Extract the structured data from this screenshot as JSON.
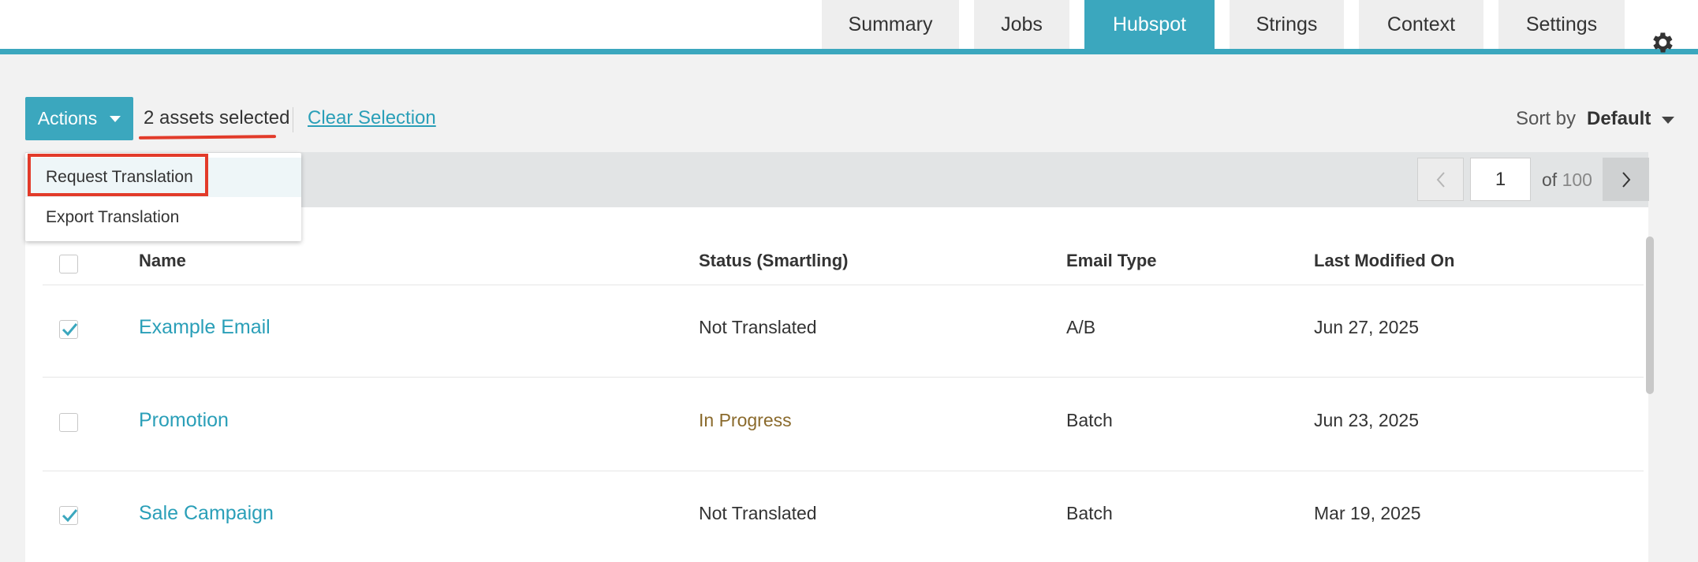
{
  "tabs": [
    {
      "label": "Summary"
    },
    {
      "label": "Jobs"
    },
    {
      "label": "Hubspot"
    },
    {
      "label": "Strings"
    },
    {
      "label": "Context"
    },
    {
      "label": "Settings"
    }
  ],
  "active_tab": "Hubspot",
  "toolbar": {
    "actions_label": "Actions",
    "selected_text": "2 assets selected",
    "clear_selection": "Clear Selection",
    "sort_label": "Sort by",
    "sort_value": "Default"
  },
  "actions_menu": {
    "items": [
      "Request Translation",
      "Export Translation"
    ]
  },
  "pagination": {
    "current": "1",
    "of_label": "of",
    "total": "100"
  },
  "table": {
    "headers": {
      "name": "Name",
      "status": "Status (Smartling)",
      "email_type": "Email Type",
      "modified": "Last Modified On"
    },
    "rows": [
      {
        "name": "Example Email",
        "status": "Not Translated",
        "email_type": "A/B",
        "modified": "Jun 27, 2025",
        "checked": true
      },
      {
        "name": "Promotion",
        "status": "In Progress",
        "email_type": "Batch",
        "modified": "Jun 23, 2025",
        "checked": false
      },
      {
        "name": "Sale Campaign",
        "status": "Not Translated",
        "email_type": "Batch",
        "modified": "Mar 19, 2025",
        "checked": true
      }
    ]
  },
  "colors": {
    "accent": "#3ba7be",
    "link": "#2a9fb8",
    "in_progress": "#8a6a2c",
    "annotation_red": "#e23b2a"
  },
  "icons": {
    "settings": "gear-icon",
    "actions_caret": "caret-down-icon",
    "sort_caret": "caret-down-icon",
    "prev_page": "chevron-left-icon",
    "next_page": "chevron-right-icon",
    "row_check": "checkmark-icon"
  }
}
